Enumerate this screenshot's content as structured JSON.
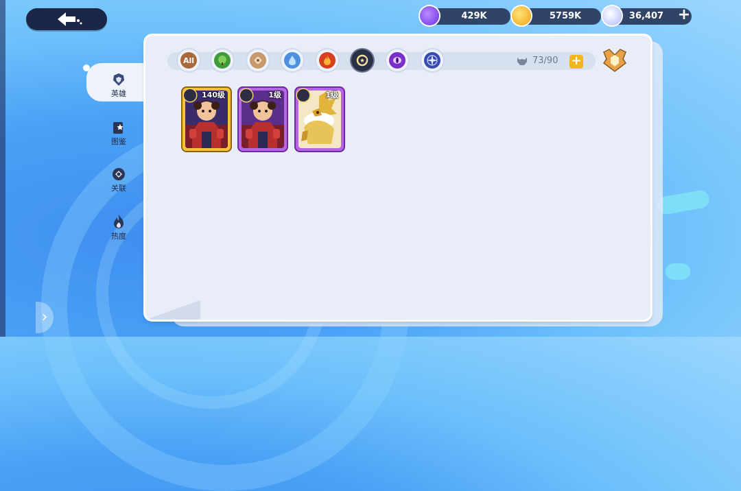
{
  "header": {
    "back_label": "back",
    "currencies": [
      {
        "name": "purple-energy",
        "value": "429K",
        "color": "#7a3ff0"
      },
      {
        "name": "gold-coin",
        "value": "5759K",
        "color": "#f5b417"
      },
      {
        "name": "diamond",
        "value": "36,407",
        "color": "#cfd6ff"
      }
    ]
  },
  "sidebar": {
    "items": [
      {
        "label": "英雄",
        "icon": "hero-icon",
        "active": true
      },
      {
        "label": "图鉴",
        "icon": "codex-icon",
        "active": false
      },
      {
        "label": "关联",
        "icon": "link-icon",
        "active": false
      },
      {
        "label": "热度",
        "icon": "flame-icon",
        "active": false
      }
    ]
  },
  "filters": {
    "all_label": "All",
    "elements": [
      "all",
      "nature",
      "earth",
      "water",
      "fire",
      "light",
      "dark",
      "star"
    ],
    "active": "light",
    "count": "73/90"
  },
  "heroes": [
    {
      "level": "140级",
      "rarity": "gold"
    },
    {
      "level": "1级",
      "rarity": "purple"
    },
    {
      "level": "1级",
      "rarity": "purple"
    }
  ],
  "colors": {
    "panel": "#e8edf8",
    "accent_gold": "#f6c338",
    "accent_purple": "#b765e8"
  }
}
